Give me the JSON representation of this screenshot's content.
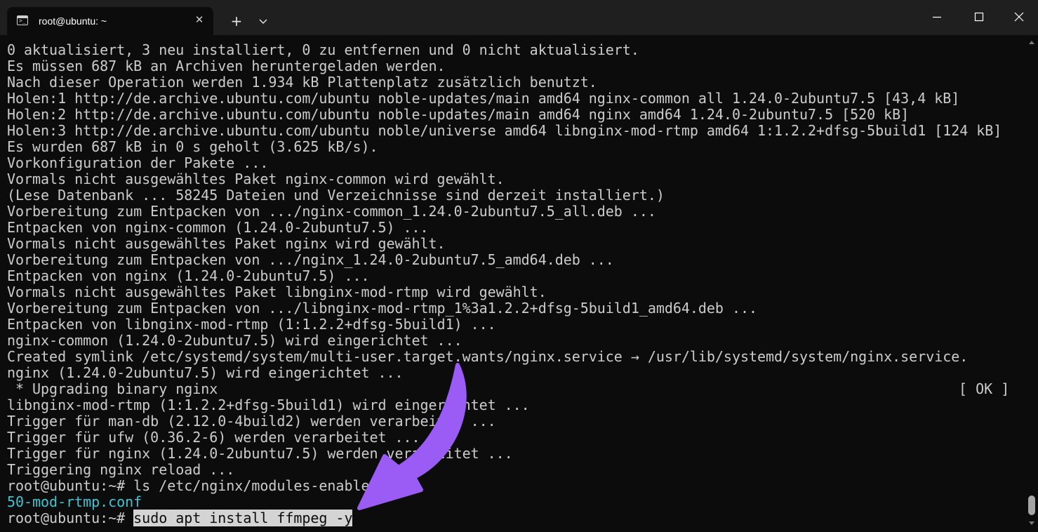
{
  "window": {
    "tab_title": "root@ubuntu: ~",
    "new_tab_icon": "plus-icon",
    "dropdown_icon": "chevron-down-icon",
    "close_tab_icon": "close-icon",
    "controls": [
      "minimize-icon",
      "maximize-icon",
      "close-icon"
    ]
  },
  "terminal": {
    "lines": [
      "0 aktualisiert, 3 neu installiert, 0 zu entfernen und 0 nicht aktualisiert.",
      "Es müssen 687 kB an Archiven heruntergeladen werden.",
      "Nach dieser Operation werden 1.934 kB Plattenplatz zusätzlich benutzt.",
      "Holen:1 http://de.archive.ubuntu.com/ubuntu noble-updates/main amd64 nginx-common all 1.24.0-2ubuntu7.5 [43,4 kB]",
      "Holen:2 http://de.archive.ubuntu.com/ubuntu noble-updates/main amd64 nginx amd64 1.24.0-2ubuntu7.5 [520 kB]",
      "Holen:3 http://de.archive.ubuntu.com/ubuntu noble/universe amd64 libnginx-mod-rtmp amd64 1:1.2.2+dfsg-5build1 [124 kB]",
      "Es wurden 687 kB in 0 s geholt (3.625 kB/s).",
      "Vorkonfiguration der Pakete ...",
      "Vormals nicht ausgewähltes Paket nginx-common wird gewählt.",
      "(Lese Datenbank ... 58245 Dateien und Verzeichnisse sind derzeit installiert.)",
      "Vorbereitung zum Entpacken von .../nginx-common_1.24.0-2ubuntu7.5_all.deb ...",
      "Entpacken von nginx-common (1.24.0-2ubuntu7.5) ...",
      "Vormals nicht ausgewähltes Paket nginx wird gewählt.",
      "Vorbereitung zum Entpacken von .../nginx_1.24.0-2ubuntu7.5_amd64.deb ...",
      "Entpacken von nginx (1.24.0-2ubuntu7.5) ...",
      "Vormals nicht ausgewähltes Paket libnginx-mod-rtmp wird gewählt.",
      "Vorbereitung zum Entpacken von .../libnginx-mod-rtmp_1%3a1.2.2+dfsg-5build1_amd64.deb ...",
      "Entpacken von libnginx-mod-rtmp (1:1.2.2+dfsg-5build1) ...",
      "nginx-common (1.24.0-2ubuntu7.5) wird eingerichtet ...",
      "Created symlink /etc/systemd/system/multi-user.target.wants/nginx.service → /usr/lib/systemd/system/nginx.service.",
      "nginx (1.24.0-2ubuntu7.5) wird eingerichtet ...",
      " * Upgrading binary nginx",
      "libnginx-mod-rtmp (1:1.2.2+dfsg-5build1) wird eingerichtet ...",
      "Trigger für man-db (2.12.0-4build2) werden verarbeitet ...",
      "Trigger für ufw (0.36.2-6) werden verarbeitet ...",
      "Trigger für nginx (1.24.0-2ubuntu7.5) werden verarbeitet ...",
      "Triggering nginx reload ...",
      "root@ubuntu:~# ls /etc/nginx/modules-enabled/",
      "50-mod-rtmp.conf"
    ],
    "ok_status": "[ OK ]",
    "prompt": "root@ubuntu:~# ",
    "current_command": "sudo apt install ffmpeg -y"
  },
  "colors": {
    "background": "#0c0c0c",
    "text": "#cccccc",
    "directory_listing": "#3fc4d2",
    "annotation_arrow": "#9b5cf6"
  },
  "annotation": {
    "icon": "curved-arrow-annotation"
  }
}
